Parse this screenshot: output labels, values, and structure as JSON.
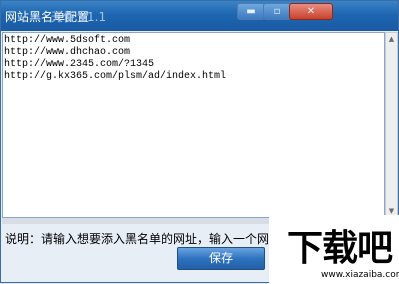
{
  "window": {
    "title": "网站黑名单配置",
    "title_overlay": "天使 V1.1",
    "minimize_glyph": "▬",
    "maximize_glyph": "▫",
    "close_glyph": "✕"
  },
  "editor": {
    "lines": [
      "http://www.5dsoft.com",
      "http://www.dhchao.com",
      "http://www.2345.com/?1345",
      "http://g.kx365.com/plsm/ad/index.html"
    ]
  },
  "status": {
    "text": "说明：请输入想要添入黑名单的网址，输入一个网"
  },
  "buttons": {
    "save": "保存"
  },
  "watermark": {
    "brand": "下载吧",
    "url": "www.xiazaiba.com"
  }
}
